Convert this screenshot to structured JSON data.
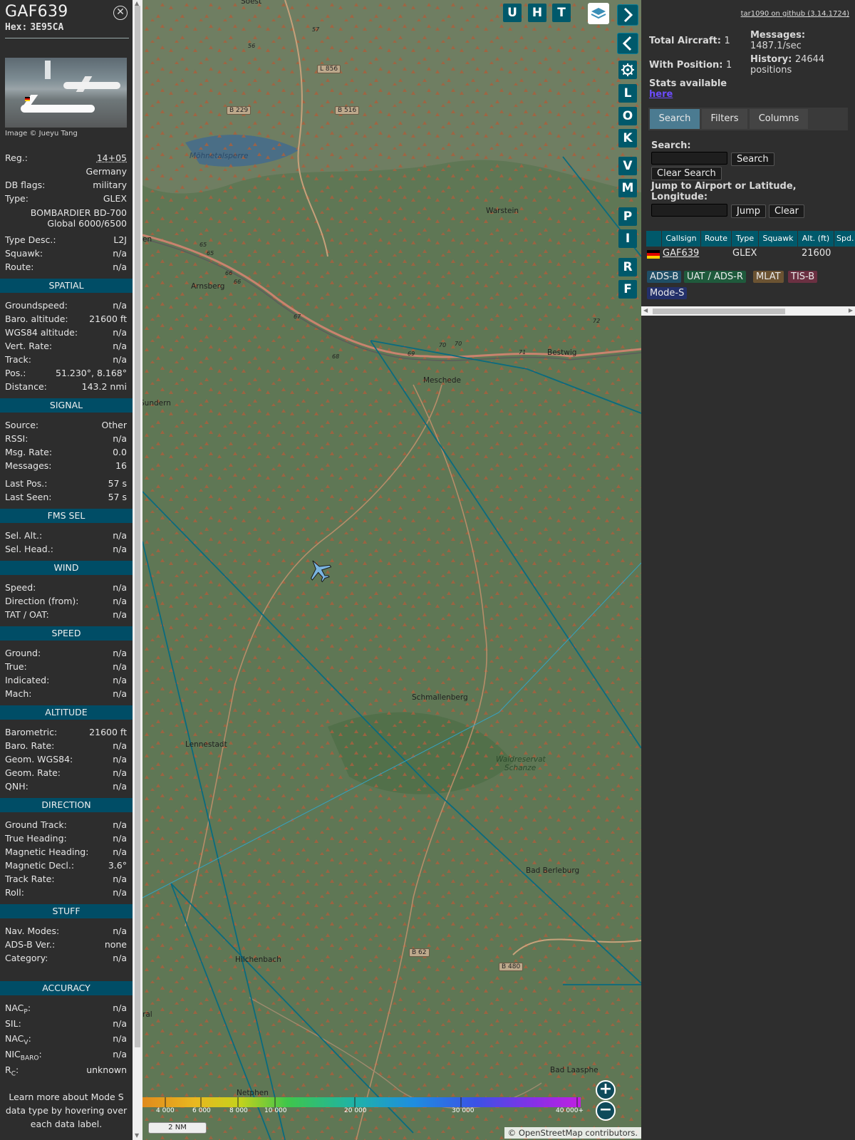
{
  "aircraft": {
    "callsign": "GAF639",
    "hex_label": "Hex:",
    "hex": "3E95CA",
    "photo_credit": "Image © Jueyu Tang",
    "close_icon": "close-icon"
  },
  "info": {
    "reg_label": "Reg.:",
    "reg": "14+05",
    "country": "Germany",
    "dbflags_label": "DB flags:",
    "dbflags": "military",
    "type_label": "Type:",
    "type": "GLEX",
    "type_full_1": "BOMBARDIER BD-700",
    "type_full_2": "Global 6000/6500",
    "typedesc_label": "Type Desc.:",
    "typedesc": "L2J",
    "squawk_label": "Squawk:",
    "squawk": "n/a",
    "route_label": "Route:",
    "route": "n/a"
  },
  "sections": {
    "spatial": "SPATIAL",
    "signal": "SIGNAL",
    "fms": "FMS SEL",
    "wind": "WIND",
    "speed": "SPEED",
    "altitude": "ALTITUDE",
    "direction": "DIRECTION",
    "stuff": "STUFF",
    "accuracy": "ACCURACY"
  },
  "spatial": {
    "gs_label": "Groundspeed:",
    "gs": "n/a",
    "baro_label": "Baro. altitude:",
    "baro": "21600 ft",
    "wgs_label": "WGS84 altitude:",
    "wgs": "n/a",
    "vr_label": "Vert. Rate:",
    "vr": "n/a",
    "track_label": "Track:",
    "track": "n/a",
    "pos_label": "Pos.:",
    "pos": "51.230°, 8.168°",
    "dist_label": "Distance:",
    "dist": "143.2 nmi"
  },
  "signal": {
    "source_label": "Source:",
    "source": "Other",
    "rssi_label": "RSSI:",
    "rssi": "n/a",
    "msgrate_label": "Msg. Rate:",
    "msgrate": "0.0",
    "messages_label": "Messages:",
    "messages": "16",
    "lastpos_label": "Last Pos.:",
    "lastpos": "57 s",
    "lastseen_label": "Last Seen:",
    "lastseen": "57 s"
  },
  "fms": {
    "selalt_label": "Sel. Alt.:",
    "selalt": "n/a",
    "selhead_label": "Sel. Head.:",
    "selhead": "n/a"
  },
  "wind": {
    "speed_label": "Speed:",
    "speed": "n/a",
    "dir_label": "Direction (from):",
    "dir": "n/a",
    "tat_label": "TAT / OAT:",
    "tat": "n/a"
  },
  "speed": {
    "ground_label": "Ground:",
    "ground": "n/a",
    "true_label": "True:",
    "true": "n/a",
    "ind_label": "Indicated:",
    "ind": "n/a",
    "mach_label": "Mach:",
    "mach": "n/a"
  },
  "altitude": {
    "baro_label": "Barometric:",
    "baro": "21600 ft",
    "barorate_label": "Baro. Rate:",
    "barorate": "n/a",
    "geom_label": "Geom. WGS84:",
    "geom": "n/a",
    "geomrate_label": "Geom. Rate:",
    "geomrate": "n/a",
    "qnh_label": "QNH:",
    "qnh": "n/a"
  },
  "direction": {
    "gt_label": "Ground Track:",
    "gt": "n/a",
    "th_label": "True Heading:",
    "th": "n/a",
    "mh_label": "Magnetic Heading:",
    "mh": "n/a",
    "md_label": "Magnetic Decl.:",
    "md": "3.6°",
    "tr_label": "Track Rate:",
    "tr": "n/a",
    "roll_label": "Roll:",
    "roll": "n/a"
  },
  "stuff": {
    "nav_label": "Nav. Modes:",
    "nav": "n/a",
    "adsb_label": "ADS-B Ver.:",
    "adsb": "none",
    "cat_label": "Category:",
    "cat": "n/a"
  },
  "accuracy": {
    "nacp_main": "NAC",
    "nacp_sub": "P",
    "nacp": "n/a",
    "sil_label": "SIL:",
    "sil": "n/a",
    "nacv_main": "NAC",
    "nacv_sub": "V",
    "nacv": "n/a",
    "nic_main": "NIC",
    "nic_sub": "BARO",
    "nic": "n/a",
    "rc_main": "R",
    "rc_sub": "C",
    "rc": "unknown"
  },
  "footer_note": "Learn more about Mode S data type by hovering over each data label.",
  "map": {
    "towns": [
      "Soest",
      "Möhnetalsperre",
      "Warstein",
      "Arnsberg",
      "Bestwig",
      "Meschede",
      "Sundern",
      "Schmallenberg",
      "Lennestadt",
      "Waldreservat",
      "Schanze",
      "Bad Berleburg",
      "Hilchenbach",
      "Bad Laasphe",
      "Netphen",
      "en",
      "ral"
    ],
    "road_labels": [
      "L 856",
      "B 229",
      "B 516",
      "B 62",
      "B 480"
    ],
    "motorway_labels": [
      "57",
      "56",
      "65",
      "65",
      "66",
      "66",
      "67",
      "68",
      "69",
      "70",
      "70",
      "71",
      "72"
    ],
    "buttons": [
      "U",
      "H",
      "T"
    ],
    "side_buttons": [
      "L",
      "O",
      "K",
      "V",
      "M",
      "P",
      "I",
      "R",
      "F"
    ],
    "altitude_labels": [
      "4 000",
      "6 000",
      "8 000",
      "10 000",
      "20 000",
      "30 000",
      "40 000+"
    ],
    "scale_label": "2 NM",
    "attribution_prefix": "©",
    "attribution_link": "OpenStreetMap",
    "attribution_suffix": "contributors."
  },
  "sidebar": {
    "github": "tar1090 on github (3.14.1724)",
    "total_label": "Total Aircraft:",
    "total": "1",
    "withpos_label": "With Position:",
    "withpos": "1",
    "messages_label": "Messages:",
    "messages": "1487.1/sec",
    "history_label": "History:",
    "history": "24644 positions",
    "stats_label": "Stats available",
    "stats_link": "here",
    "tabs": [
      "Search",
      "Filters",
      "Columns"
    ],
    "search_label": "Search:",
    "search_button": "Search",
    "clear_search": "Clear Search",
    "jump_label": "Jump to Airport or Latitude, Longitude:",
    "jump_button": "Jump",
    "clear_button": "Clear",
    "table_headers": [
      "Callsign",
      "Route",
      "Type",
      "Squawk",
      "Alt. (ft)",
      "Spd."
    ],
    "table_row": {
      "callsign": "GAF639",
      "type": "GLEX",
      "alt": "21600"
    },
    "badges": [
      "ADS-B",
      "UAT / ADS-R",
      "MLAT",
      "TIS-B",
      "Mode-S"
    ]
  }
}
